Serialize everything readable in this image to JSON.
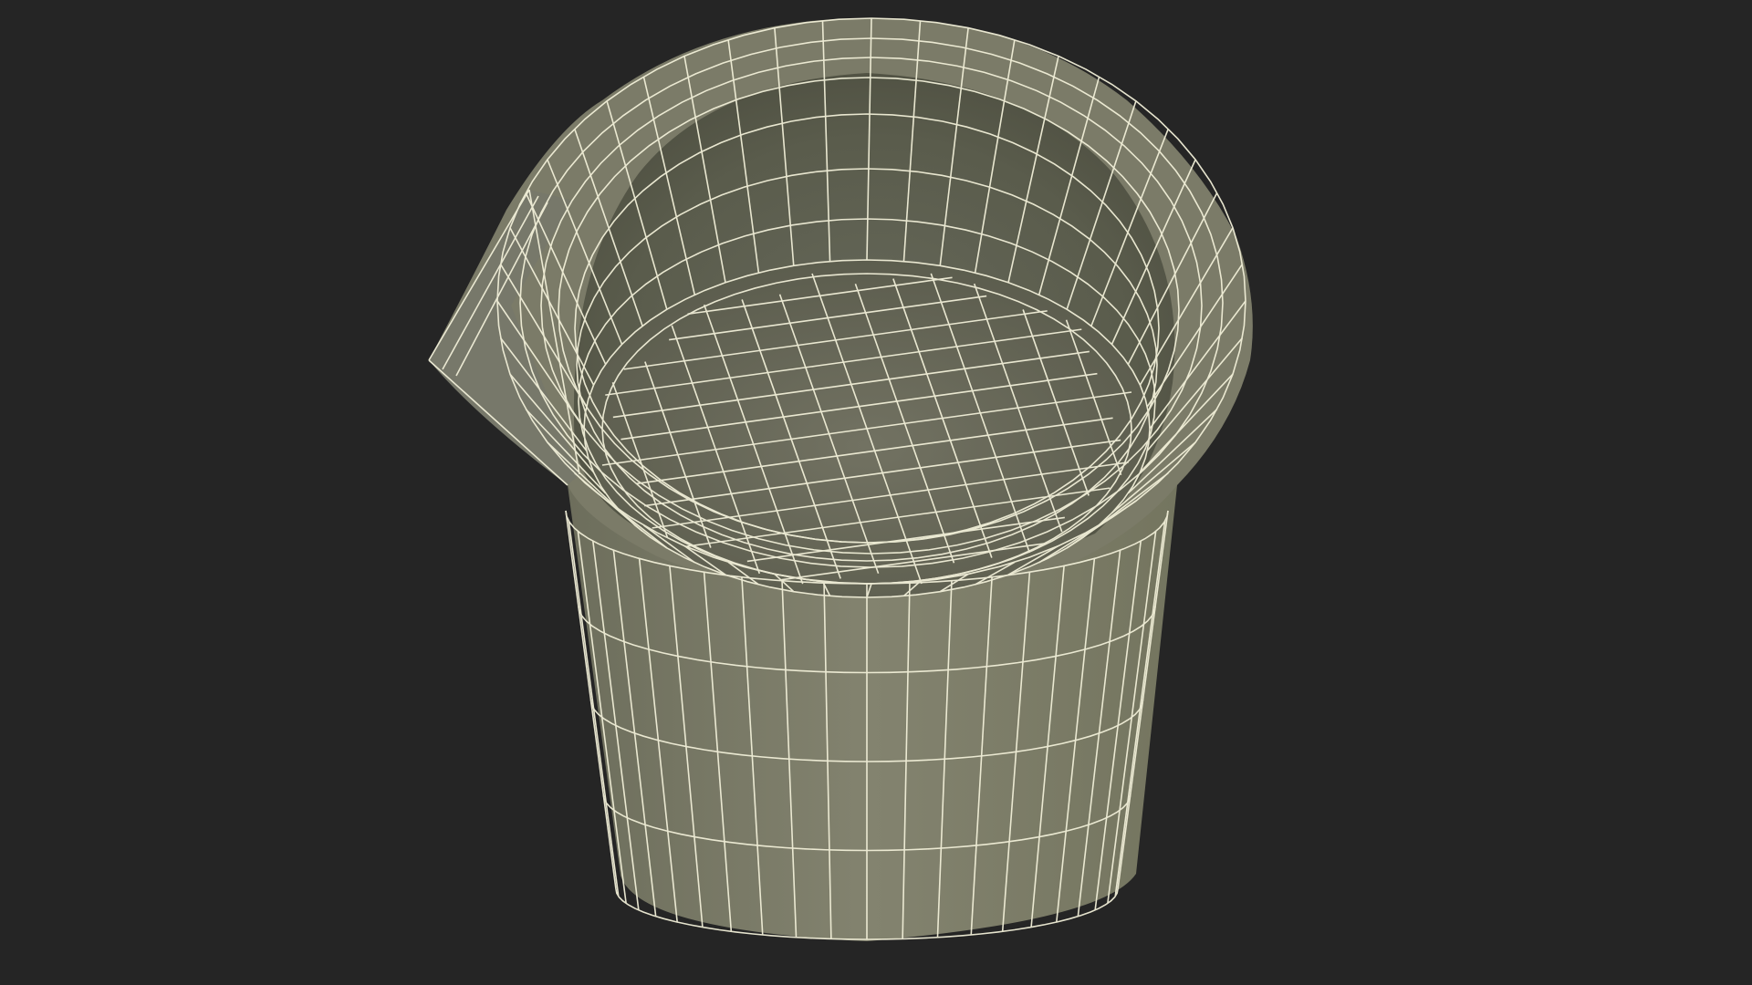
{
  "scene": {
    "subject": "wireframe-beaker-with-spout",
    "background_color": "#252525",
    "mesh_fill_color": "#7b7b68",
    "mesh_fill_inner_color": "#5c5e4c",
    "wire_color": "#f1efd8"
  }
}
